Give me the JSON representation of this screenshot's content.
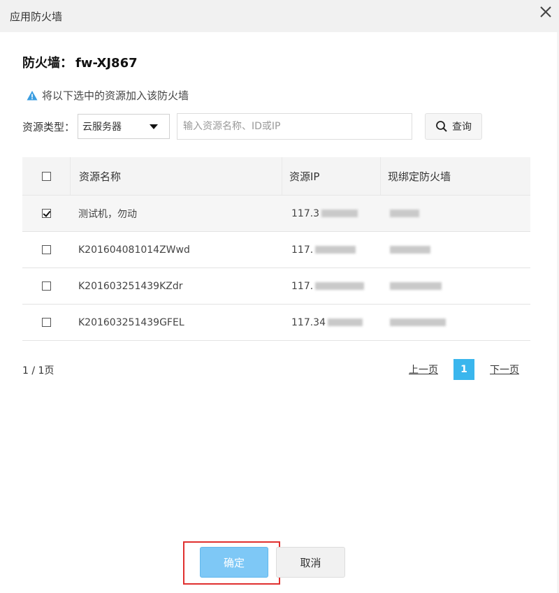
{
  "dialog": {
    "title": "应用防火墙"
  },
  "firewall": {
    "label": "防火墙：",
    "name": "fw-XJ867"
  },
  "notice": {
    "text": "将以下选中的资源加入该防火墙"
  },
  "filter": {
    "type_label": "资源类型：",
    "type_value": "云服务器",
    "search_placeholder": "输入资源名称、ID或IP",
    "query_label": "查询"
  },
  "table": {
    "headers": [
      "资源名称",
      "资源IP",
      "现绑定防火墙"
    ],
    "rows": [
      {
        "name": "测试机，勿动",
        "ip": "117.3",
        "checked": true
      },
      {
        "name": "K201604081014ZWwd",
        "ip": "117.",
        "checked": false
      },
      {
        "name": "K201603251439KZdr",
        "ip": "117.",
        "checked": false
      },
      {
        "name": "K201603251439GFEL",
        "ip": "117.34",
        "checked": false
      }
    ]
  },
  "pagination": {
    "count": "1 / 1页",
    "prev": "上一页",
    "current": "1",
    "next": "下一页"
  },
  "footer": {
    "confirm": "确定",
    "cancel": "取消"
  },
  "colors": {
    "accent": "#3ab6ed",
    "confirm_bg": "#7ec8f6",
    "highlight": "#e0302f",
    "warning": "#3a9de0"
  }
}
